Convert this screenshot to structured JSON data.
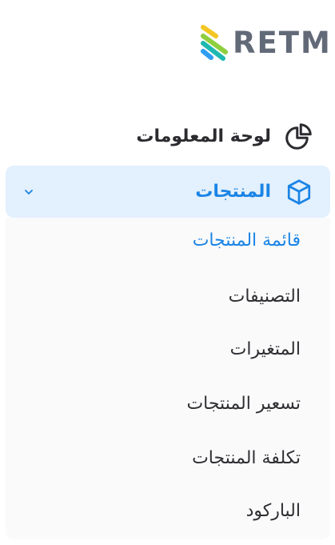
{
  "brand": {
    "logo_text": "RETM",
    "logo_colors": [
      "#f3c623",
      "#1fb8b1",
      "#2e9df2",
      "#8fcf3f"
    ]
  },
  "nav": {
    "dashboard": {
      "label": "لوحة المعلومات",
      "icon": "pie-chart-icon"
    },
    "products": {
      "label": "المنتجات",
      "icon": "cube-icon",
      "expanded": true,
      "accent": "#1a84e6"
    },
    "submenu": [
      {
        "label": "قائمة المنتجات",
        "active": true
      },
      {
        "label": "التصنيفات",
        "active": false
      },
      {
        "label": "المتغيرات",
        "active": false
      },
      {
        "label": "تسعير المنتجات",
        "active": false
      },
      {
        "label": "تكلفة المنتجات",
        "active": false
      },
      {
        "label": "الباركود",
        "active": false
      }
    ]
  }
}
